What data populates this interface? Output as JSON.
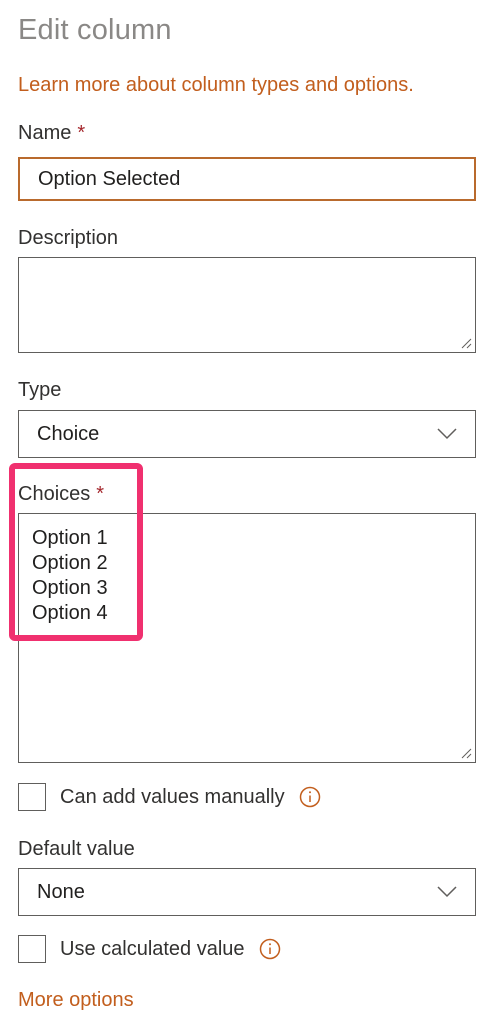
{
  "panel": {
    "title": "Edit column",
    "learn_more_link": "Learn more about column types and options."
  },
  "name_field": {
    "label": "Name",
    "required_marker": "*",
    "value": "Option Selected"
  },
  "description_field": {
    "label": "Description",
    "value": ""
  },
  "type_field": {
    "label": "Type",
    "selected": "Choice"
  },
  "choices_field": {
    "label": "Choices",
    "required_marker": "*",
    "options": [
      "Option 1",
      "Option 2",
      "Option 3",
      "Option 4"
    ]
  },
  "manual_values": {
    "label": "Can add values manually",
    "checked": false,
    "icon": "info-icon"
  },
  "default_value": {
    "label": "Default value",
    "selected": "None"
  },
  "calculated_value": {
    "label": "Use calculated value",
    "checked": false,
    "icon": "info-icon"
  },
  "more_options": "More options",
  "colors": {
    "link": "#c25e1d",
    "required": "#a4262c",
    "focus_border": "#b96a2d",
    "highlight": "#f0306f"
  }
}
